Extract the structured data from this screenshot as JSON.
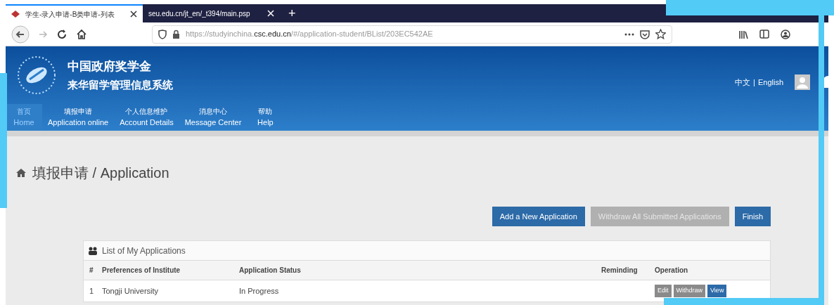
{
  "browser": {
    "tabs": [
      {
        "title": "学生-录入申请-B类申请-列表",
        "selected": true
      },
      {
        "title": "seu.edu.cn/jt_en/_t394/main.psp",
        "selected": false
      }
    ],
    "new_tab": "+",
    "url_prefix": "https://studyinchina.",
    "url_host": "csc.edu.cn",
    "url_path": "/#/application-student/BList/203EC542AE"
  },
  "header": {
    "title_line_1": "中国政府奖学金",
    "title_line_2": "来华留学管理信息系统",
    "languages": [
      "中文",
      "English"
    ],
    "language_separator": "|"
  },
  "nav": [
    {
      "zh": "首页",
      "en": "Home",
      "selected": true
    },
    {
      "zh": "填报申请",
      "en": "Application online",
      "selected": false
    },
    {
      "zh": "个人信息维护",
      "en": "Account Details",
      "selected": false
    },
    {
      "zh": "消息中心",
      "en": "Message Center",
      "selected": false
    },
    {
      "zh": "帮助",
      "en": "Help",
      "selected": false
    }
  ],
  "page_title": "填报申请 / Application",
  "actions": [
    {
      "label": "Add a New Application",
      "disabled": false
    },
    {
      "label": "Withdraw All Submitted Applications",
      "disabled": true
    },
    {
      "label": "Finish",
      "disabled": false
    }
  ],
  "panel": {
    "title": "List of My Applications",
    "columns": [
      "#",
      "Preferences of Institute",
      "Application Status",
      "Reminding",
      "Operation"
    ],
    "rows": [
      {
        "index": "1",
        "institute": "Tongji University",
        "status": "In Progress",
        "operations": [
          {
            "label": "Edit",
            "disabled": true
          },
          {
            "label": "Withdraw",
            "disabled": true
          },
          {
            "label": "View",
            "disabled": false
          }
        ]
      }
    ]
  }
}
